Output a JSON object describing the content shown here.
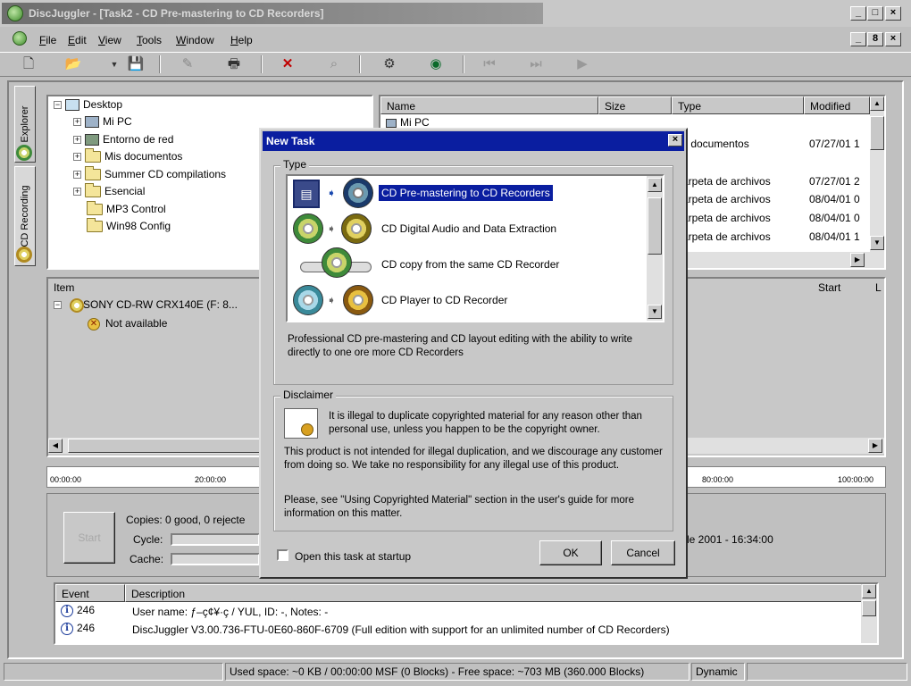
{
  "window": {
    "title": "DiscJuggler - [Task2 - CD Pre-mastering to CD Recorders]",
    "caption_buttons": [
      "_",
      "□",
      "×"
    ],
    "mdi_buttons": [
      "_",
      "8",
      "×"
    ]
  },
  "menu": [
    "File",
    "Edit",
    "View",
    "Tools",
    "Window",
    "Help"
  ],
  "toolbar": [
    "new-icon",
    "open-icon",
    "save-icon",
    "properties-icon",
    "print-icon",
    "delete-icon",
    "find-icon",
    "task-icon",
    "cd-info-icon",
    "rewind-icon",
    "fast-forward-icon",
    "play-icon"
  ],
  "side_tabs": [
    "Explorer",
    "CD Recording"
  ],
  "tree": {
    "root": "Desktop",
    "items": [
      "Mi PC",
      "Entorno de red",
      "Mis documentos",
      "Summer CD compilations",
      "Esencial",
      "MP3 Control",
      "Win98 Config"
    ]
  },
  "file_list": {
    "columns": [
      "Name",
      "Size",
      "Type",
      "Modified"
    ],
    "rows": [
      {
        "name": "Mi PC",
        "type": "",
        "modified": ""
      },
      {
        "name": "",
        "type": "s documentos",
        "modified": "07/27/01 1"
      },
      {
        "name": "",
        "type": "arpeta de archivos",
        "modified": "07/27/01 2"
      },
      {
        "name": "",
        "type": "arpeta de archivos",
        "modified": "08/04/01 0"
      },
      {
        "name": "",
        "type": "arpeta de archivos",
        "modified": "08/04/01 0"
      },
      {
        "name": "",
        "type": "arpeta de archivos",
        "modified": "08/04/01 1"
      }
    ]
  },
  "devices": {
    "columns": [
      "Item",
      "Start",
      "L"
    ],
    "device": "SONY CD-RW  CRX140E (F: 8...",
    "status": "Not available"
  },
  "timeline": [
    "00:00:00",
    "20:00:00",
    "80:00:00",
    "100:00:00"
  ],
  "progress": {
    "start_label": "Start",
    "copies": "Copies:  0 good, 0 rejecte",
    "cycle": "Cycle:",
    "cache": "Cache:",
    "date": "de 2001 - 16:34:00"
  },
  "log": {
    "columns": [
      "Event",
      "Description"
    ],
    "rows": [
      {
        "event": "246",
        "desc": "User name: ƒ–ç¢¥·ç / YUL, ID: -, Notes: -"
      },
      {
        "event": "246",
        "desc": "DiscJuggler V3.00.736-FTU-0E60-860F-6709 (Full edition with support for an unlimited number of CD Recorders)"
      }
    ]
  },
  "dialog": {
    "title": "New Task",
    "type_label": "Type",
    "tasks": [
      "CD Pre-mastering to CD Recorders",
      "CD Digital Audio and Data Extraction",
      "CD copy from the same CD Recorder",
      "CD Player to CD Recorder"
    ],
    "selected_index": 0,
    "description": "Professional CD pre-mastering and CD layout editing with the ability to write directly to one ore more CD Recorders",
    "disclaimer_label": "Disclaimer",
    "disclaimer_1": "It is illegal to duplicate copyrighted material for any reason other than personal use, unless you happen to be the copyright owner.",
    "disclaimer_2": "This product is not intended for illegal duplication, and we discourage any customer from doing so. We take no responsibility for any illegal use of this product.",
    "disclaimer_3": "Please, see \"Using Copyrighted Material\" section in the user's guide for more information on this matter.",
    "checkbox_label": "Open this task at startup",
    "ok": "OK",
    "cancel": "Cancel"
  },
  "statusbar": {
    "space": "Used space: ~0 KB / 00:00:00 MSF (0 Blocks) - Free space: ~703 MB (360.000 Blocks)",
    "mode": "Dynamic"
  }
}
